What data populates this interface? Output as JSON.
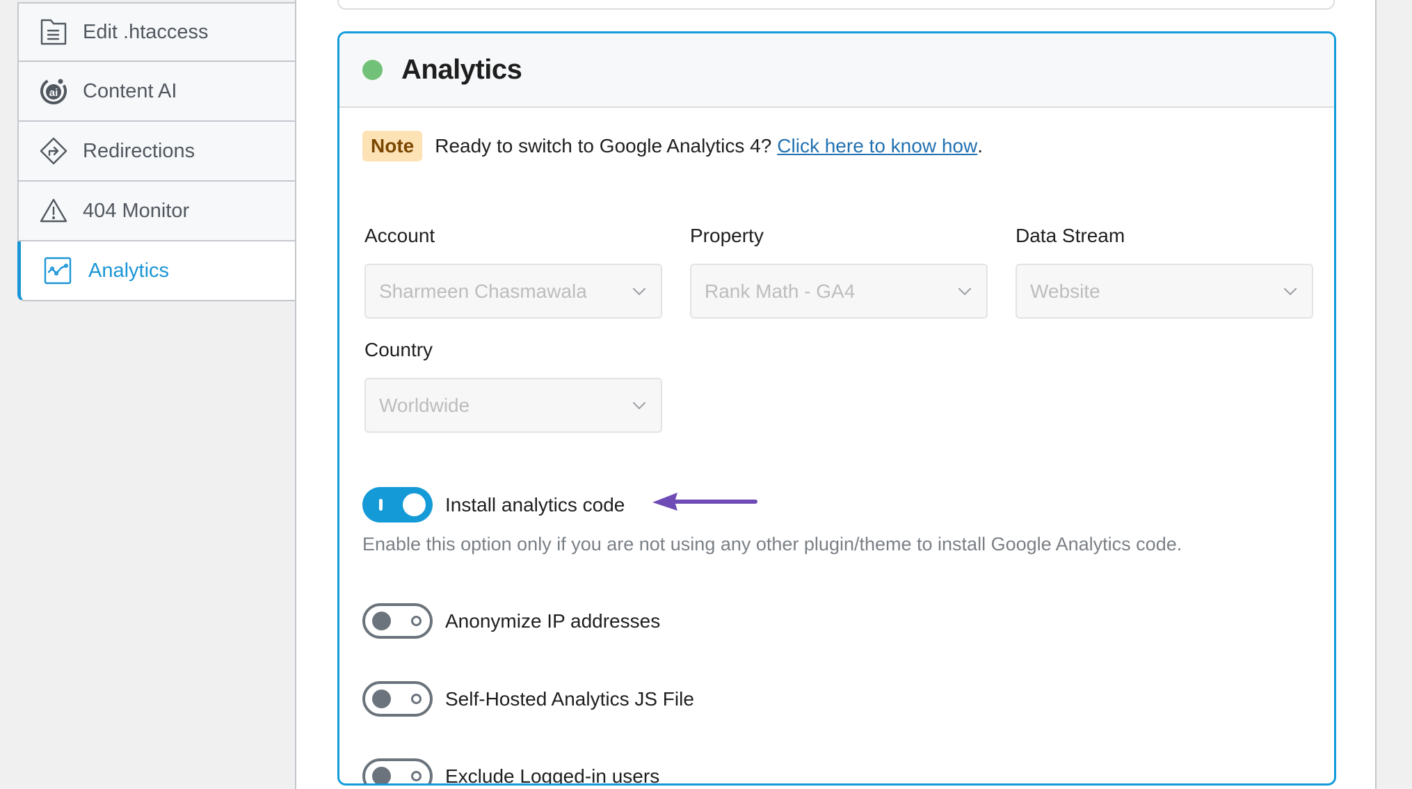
{
  "sidebar": {
    "items": [
      {
        "label": "Edit .htaccess",
        "icon": "file-text-icon",
        "active": false
      },
      {
        "label": "Content AI",
        "icon": "content-ai-icon",
        "active": false
      },
      {
        "label": "Redirections",
        "icon": "redirect-icon",
        "active": false
      },
      {
        "label": "404 Monitor",
        "icon": "warning-icon",
        "active": false
      },
      {
        "label": "Analytics",
        "icon": "analytics-chart-icon",
        "active": true
      }
    ]
  },
  "card": {
    "title": "Analytics",
    "status_color": "#72c178",
    "note": {
      "badge": "Note",
      "text": "Ready to switch to Google Analytics 4?",
      "link_text": "Click here to know how",
      "suffix": "."
    },
    "fields": {
      "account": {
        "label": "Account",
        "value": "Sharmeen Chasmawala"
      },
      "property": {
        "label": "Property",
        "value": "Rank Math - GA4"
      },
      "data_stream": {
        "label": "Data Stream",
        "value": "Website"
      },
      "country": {
        "label": "Country",
        "value": "Worldwide"
      }
    },
    "toggles": {
      "install_code": {
        "label": "Install analytics code",
        "on": true,
        "description": "Enable this option only if you are not using any other plugin/theme to install Google Analytics code."
      },
      "anonymize_ip": {
        "label": "Anonymize IP addresses",
        "on": false
      },
      "self_hosted_js": {
        "label": "Self-Hosted Analytics JS File",
        "on": false
      },
      "exclude_logged_in": {
        "label": "Exclude Logged-in users",
        "on": false
      }
    }
  },
  "colors": {
    "accent": "#119bd9",
    "annotation_arrow": "#6f4cb5",
    "note_bg": "#fde2b5",
    "note_text": "#7a4700",
    "link": "#2271b1"
  }
}
